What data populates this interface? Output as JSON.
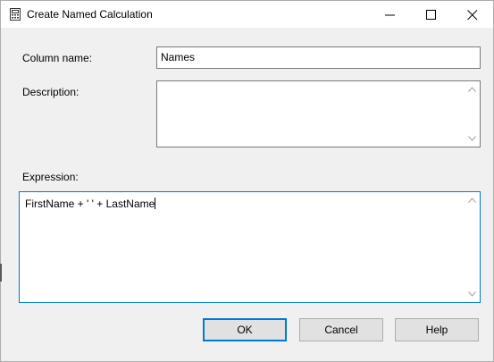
{
  "window": {
    "title": "Create Named Calculation",
    "icons": {
      "app": "calculator-icon",
      "minimize": "minimize-icon",
      "maximize": "maximize-icon",
      "close": "close-icon"
    }
  },
  "form": {
    "column_name_label": "Column name:",
    "column_name_value": "Names",
    "description_label": "Description:",
    "description_value": "",
    "expression_label": "Expression:",
    "expression_value": "FirstName + ' ' + LastName"
  },
  "buttons": {
    "ok": "OK",
    "cancel": "Cancel",
    "help": "Help"
  },
  "colors": {
    "focus_border": "#0078d7",
    "dialog_bg": "#f0f0f0"
  }
}
